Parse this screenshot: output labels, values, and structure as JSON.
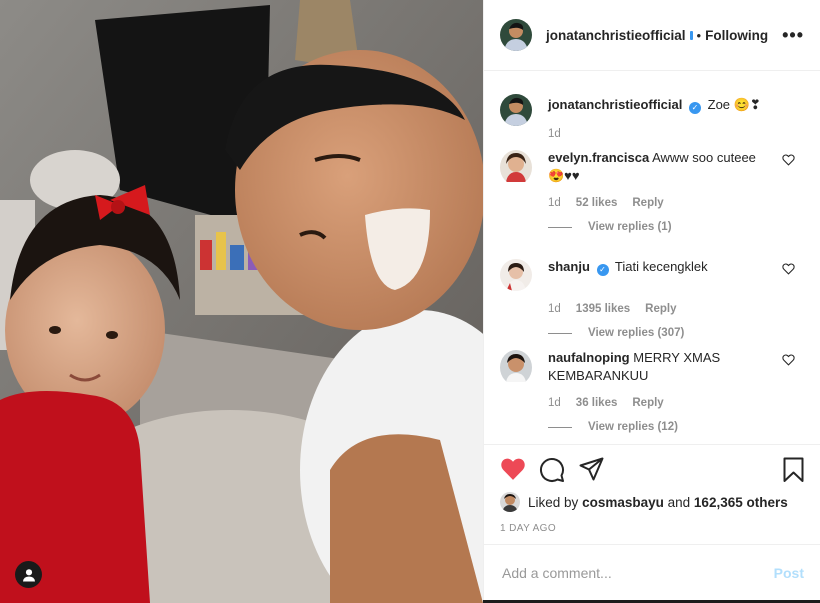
{
  "photo": {
    "alt_subject": "selfie of a smiling man with a little girl in a red bow",
    "user_tag_icon": "person-icon"
  },
  "header": {
    "username": "jonatanchristieofficial",
    "separator": "•",
    "follow_label": "Following",
    "more_icon": "more-horizontal-icon",
    "more_label": "•••"
  },
  "caption": {
    "username": "jonatanchristieofficial",
    "text": "Zoe 😊❣",
    "time": "1d"
  },
  "comments": [
    {
      "username": "evelyn.francisca",
      "text": "Awww soo cuteee 😍♥♥",
      "time": "1d",
      "likes": "52 likes",
      "reply": "Reply",
      "view_replies": "View replies (1)"
    },
    {
      "username": "shanju",
      "text": "Tiati kecengklek",
      "time": "1d",
      "likes": "1395 likes",
      "reply": "Reply",
      "view_replies": "View replies (307)"
    },
    {
      "username": "naufalnoping",
      "text": "MERRY XMAS KEMBARANKUU",
      "time": "1d",
      "likes": "36 likes",
      "reply": "Reply",
      "view_replies": "View replies (12)"
    }
  ],
  "actions": {
    "like_icon": "heart-filled-icon",
    "comment_icon": "comment-icon",
    "share_icon": "share-icon",
    "save_icon": "bookmark-icon"
  },
  "likes": {
    "prefix": "Liked by",
    "user": "cosmasbayu",
    "middle": "and",
    "count": "162,365 others"
  },
  "date": "1 DAY AGO",
  "comment_box": {
    "placeholder": "Add a comment...",
    "post_label": "Post"
  },
  "colors": {
    "like_red": "#ed4956",
    "verified_blue": "#3897f0",
    "post_disabled": "#b2dffc",
    "muted": "#8e8e8e",
    "text": "#262626"
  }
}
